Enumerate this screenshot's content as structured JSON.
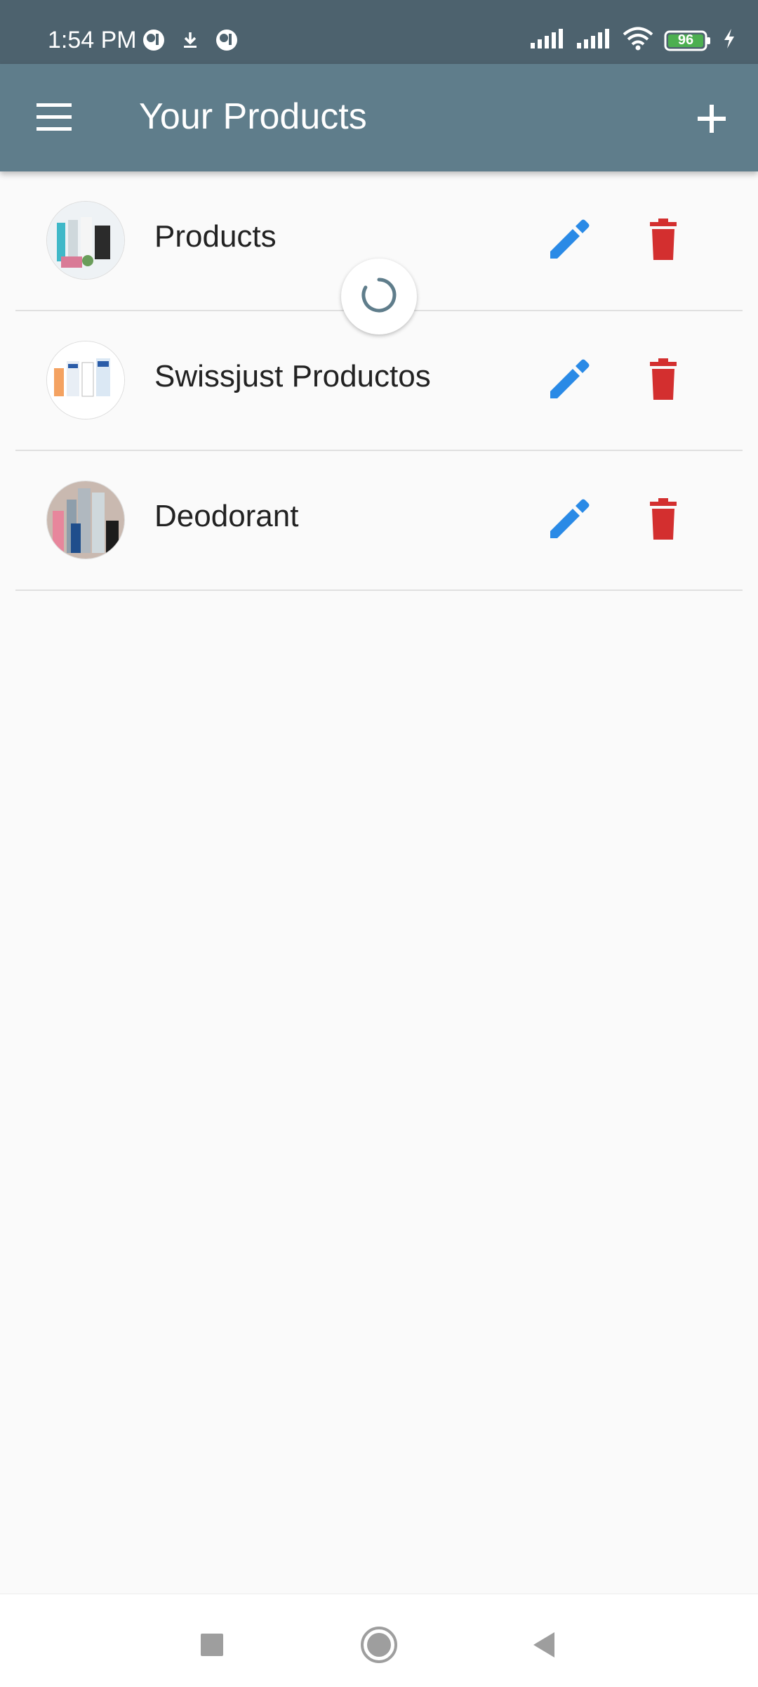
{
  "status_bar": {
    "time": "1:54 PM",
    "battery": "96",
    "icons": [
      "notification-icon",
      "download-icon",
      "notification-icon",
      "signal-icon",
      "signal-icon",
      "wifi-icon",
      "battery-icon",
      "charging-icon"
    ]
  },
  "app_bar": {
    "title": "Your Products",
    "menu_icon": "menu-icon",
    "add_icon": "add-icon"
  },
  "colors": {
    "status_bar": "#4d626e",
    "app_bar": "#5f7d8b",
    "edit": "#2a8ae6",
    "delete": "#d32f2f",
    "background": "#fafafa"
  },
  "products": [
    {
      "label": "Products"
    },
    {
      "label": "Swissjust Productos"
    },
    {
      "label": "Deodorant"
    }
  ],
  "nav_bar": {
    "icons": [
      "recents-icon",
      "home-icon",
      "back-icon"
    ]
  }
}
